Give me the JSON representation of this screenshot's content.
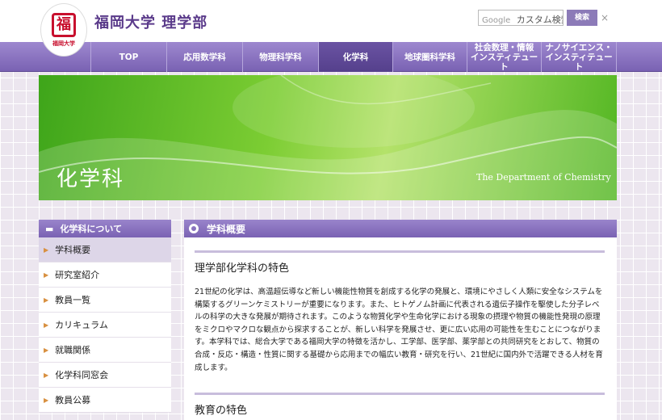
{
  "header": {
    "logo_text": "福岡大学",
    "site_title": "福岡大学 理学部",
    "search_brand": "Google",
    "search_placeholder": "カスタム検索",
    "search_button": "検索",
    "clear_symbol": "×"
  },
  "nav": {
    "items": [
      {
        "label": "TOP"
      },
      {
        "label": "応用数学科"
      },
      {
        "label": "物理科学科"
      },
      {
        "label": "化学科"
      },
      {
        "label": "地球圏科学科"
      },
      {
        "label": "社会数理・情報\nインスティテュート"
      },
      {
        "label": "ナノサイエンス・\nインスティテュート"
      }
    ],
    "active": "化学科"
  },
  "banner": {
    "title": "化学科",
    "subtitle": "The Department of Chemistry"
  },
  "sidebar": {
    "heading": "化学科について",
    "items": [
      {
        "label": "学科概要"
      },
      {
        "label": "研究室紹介"
      },
      {
        "label": "教員一覧"
      },
      {
        "label": "カリキュラム"
      },
      {
        "label": "就職関係"
      },
      {
        "label": "化学科同窓会"
      },
      {
        "label": "教員公募"
      }
    ],
    "active": "学科概要"
  },
  "main": {
    "heading": "学科概要",
    "section1_title": "理学部化学科の特色",
    "section1_body": "21世紀の化学は、高温超伝導など新しい機能性物質を創成する化学の発展と、環境にやさしく人類に安全なシステムを構築するグリーンケミストリーが重要になります。また、ヒトゲノム計画に代表される遺伝子操作を駆使した分子レベルの科学の大きな発展が期待されます。このような物質化学や生命化学における現象の摂理や物質の機能性発現の原理をミクロやマクロな観点から探求することが、新しい科学を発展させ、更に広い応用の可能性を生むことにつながります。本学科では、総合大学である福岡大学の特徴を活かし、工学部、医学部、薬学部との共同研究をとおして、物質の合成・反応・構造・性質に関する基礎から応用までの幅広い教育・研究を行い、21世紀に国内外で活躍できる人材を育成します。",
    "section2_title": "教育の特色"
  },
  "colors": {
    "nav_purple": "#7a62b3",
    "title_purple": "#5a3a8a",
    "banner_green": "#5cb828",
    "seal_red": "#c8102e"
  }
}
